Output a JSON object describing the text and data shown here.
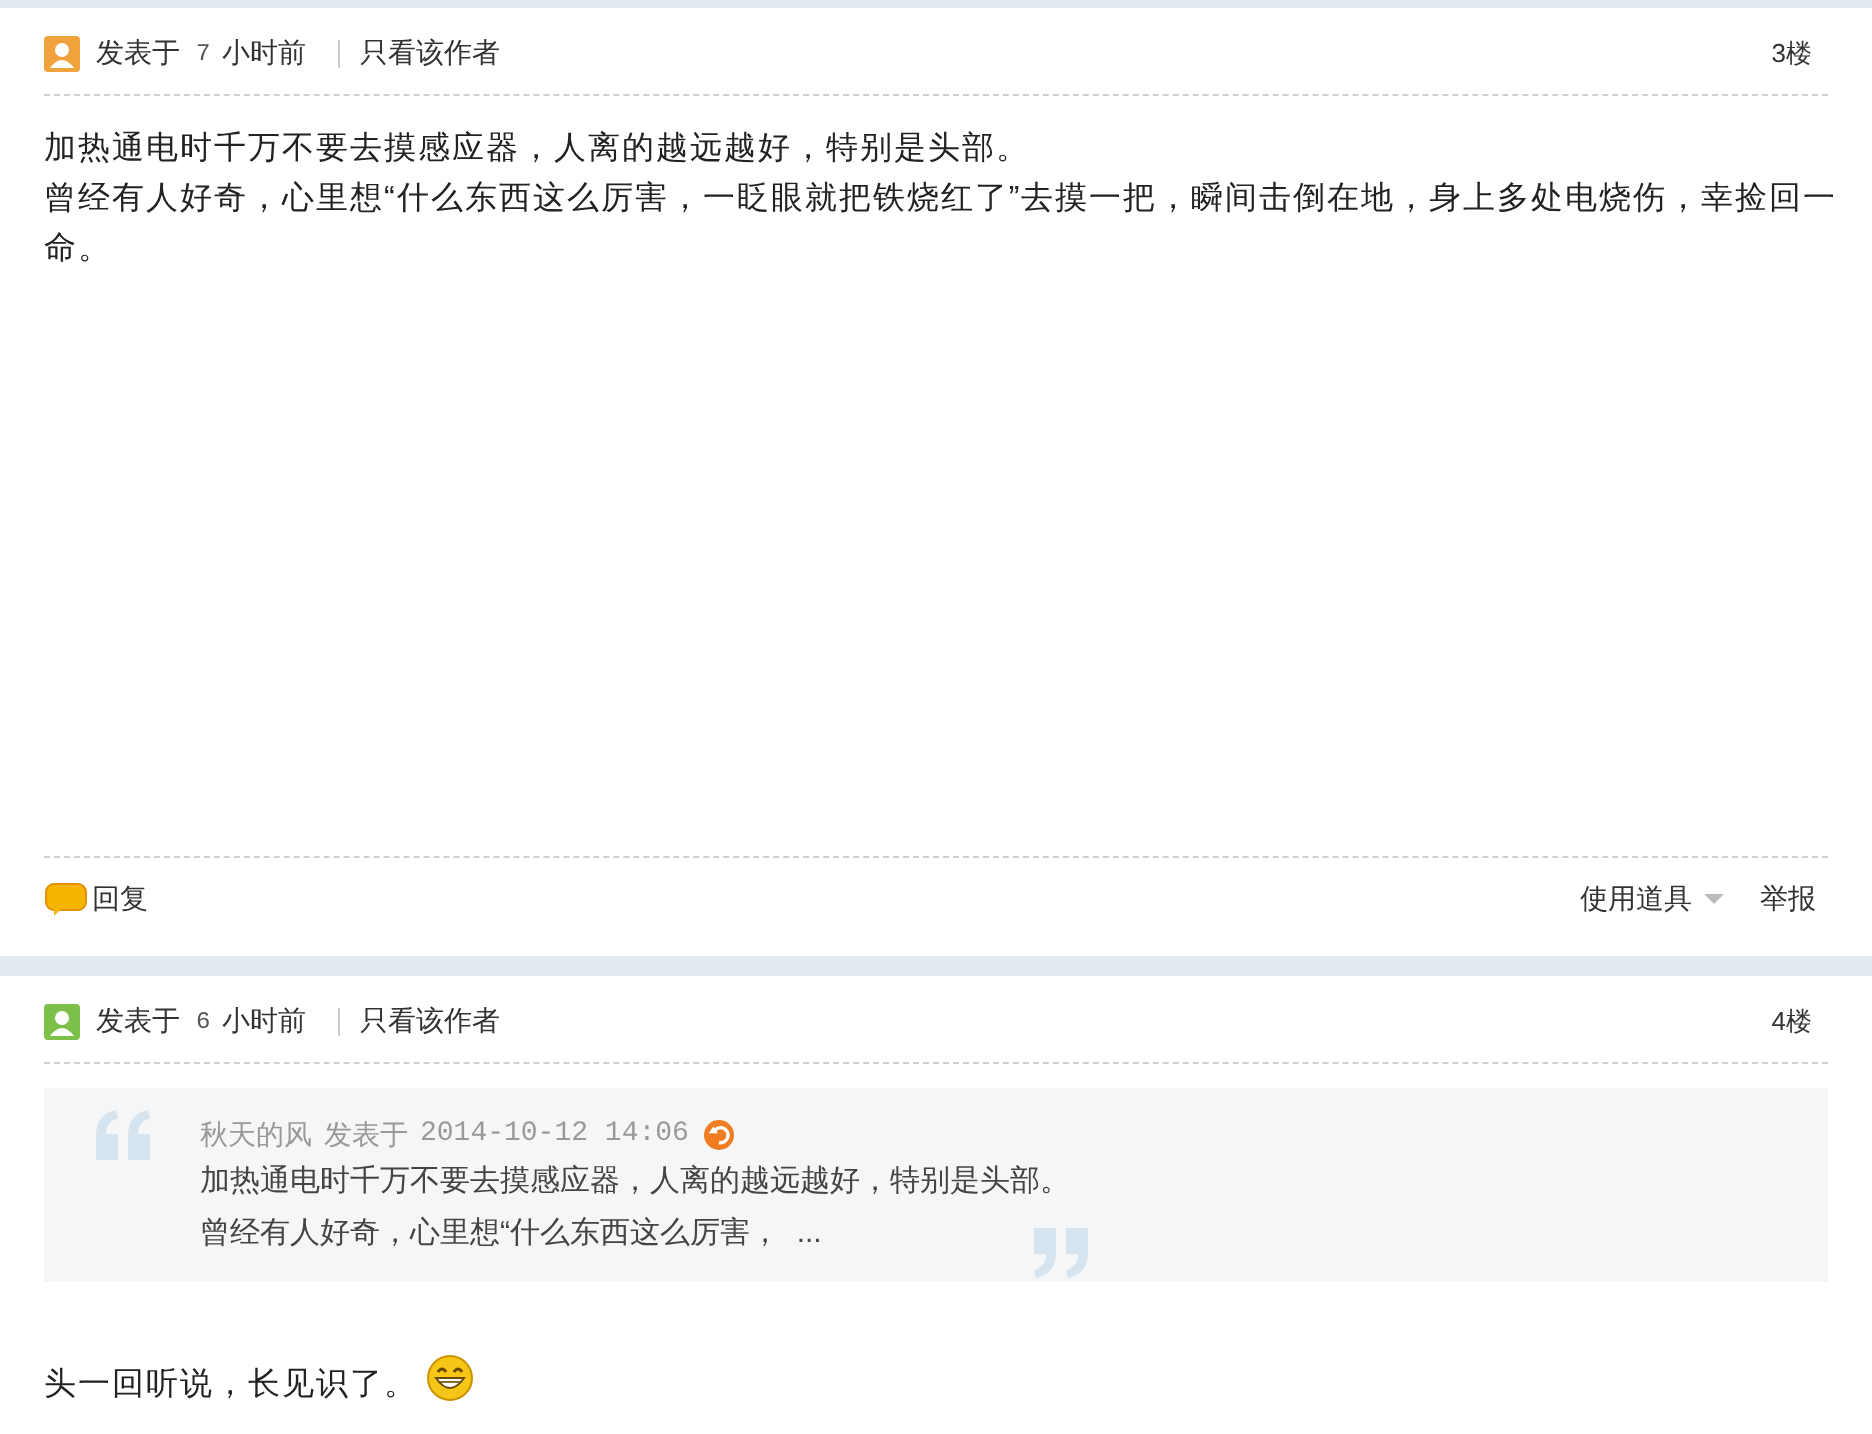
{
  "posts": [
    {
      "color": "#f0a23c",
      "posted_label": "发表于",
      "age": "7",
      "age_unit": "小时前",
      "author_only": "只看该作者",
      "floor": "3楼",
      "body": [
        "加热通电时千万不要去摸感应器，人离的越远越好，特别是头部。",
        "曾经有人好奇，心里想“什么东西这么厉害，一眨眼就把铁烧红了”去摸一把，瞬间击倒在地，身上多处电烧伤，幸捡回一命。"
      ],
      "footer": {
        "reply": "回复",
        "tools": "使用道具",
        "report": "举报"
      }
    },
    {
      "color": "#7cc04a",
      "posted_label": "发表于",
      "age": "6",
      "age_unit": "小时前",
      "author_only": "只看该作者",
      "floor": "4楼",
      "quote": {
        "author": "秋天的风",
        "posted_label": "发表于",
        "time": "2014-10-12 14:06",
        "lines": [
          "加热通电时千万不要去摸感应器，人离的越远越好，特别是头部。",
          "曾经有人好奇，心里想“什么东西这么厉害，  ..."
        ]
      },
      "body": [
        "头一回听说，长见识了。"
      ],
      "emoji": true
    }
  ]
}
